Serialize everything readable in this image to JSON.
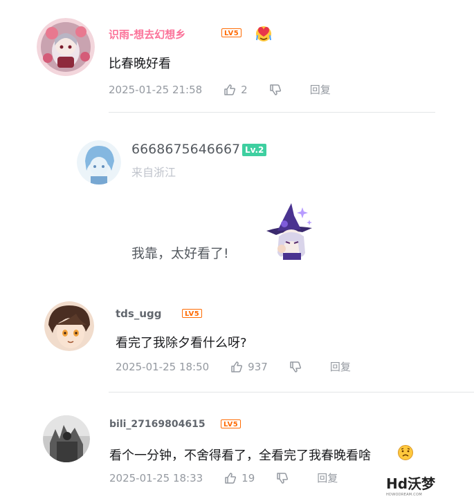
{
  "comments": [
    {
      "username": "识雨-想去幻想乡",
      "level": "LV5",
      "text": "比春晚好看",
      "date": "2025-01-25 21:58",
      "likes": "2",
      "reply_label": "回复"
    },
    {
      "username": "6668675646667",
      "level": "Lv.2",
      "location": "来自浙江",
      "text": "我靠，太好看了!"
    },
    {
      "username": "tds_ugg",
      "level": "LV5",
      "text": "看完了我除夕看什么呀?",
      "date": "2025-01-25 18:50",
      "likes": "937",
      "reply_label": "回复"
    },
    {
      "username": "bili_27169804615",
      "level": "LV5",
      "text": "看个一分钟，不舍得看了，全看完了我春晚看啥",
      "date": "2025-01-25 18:33",
      "likes": "19",
      "reply_label": "回复"
    }
  ],
  "watermark": {
    "title": "Hd沃梦",
    "subtitle": "HDWODREAM.COM"
  },
  "colors": {
    "pink_username": "#fb7299",
    "level_orange": "#ff6a00",
    "level_green": "#3ecfa0",
    "meta_gray": "#9499a0"
  }
}
